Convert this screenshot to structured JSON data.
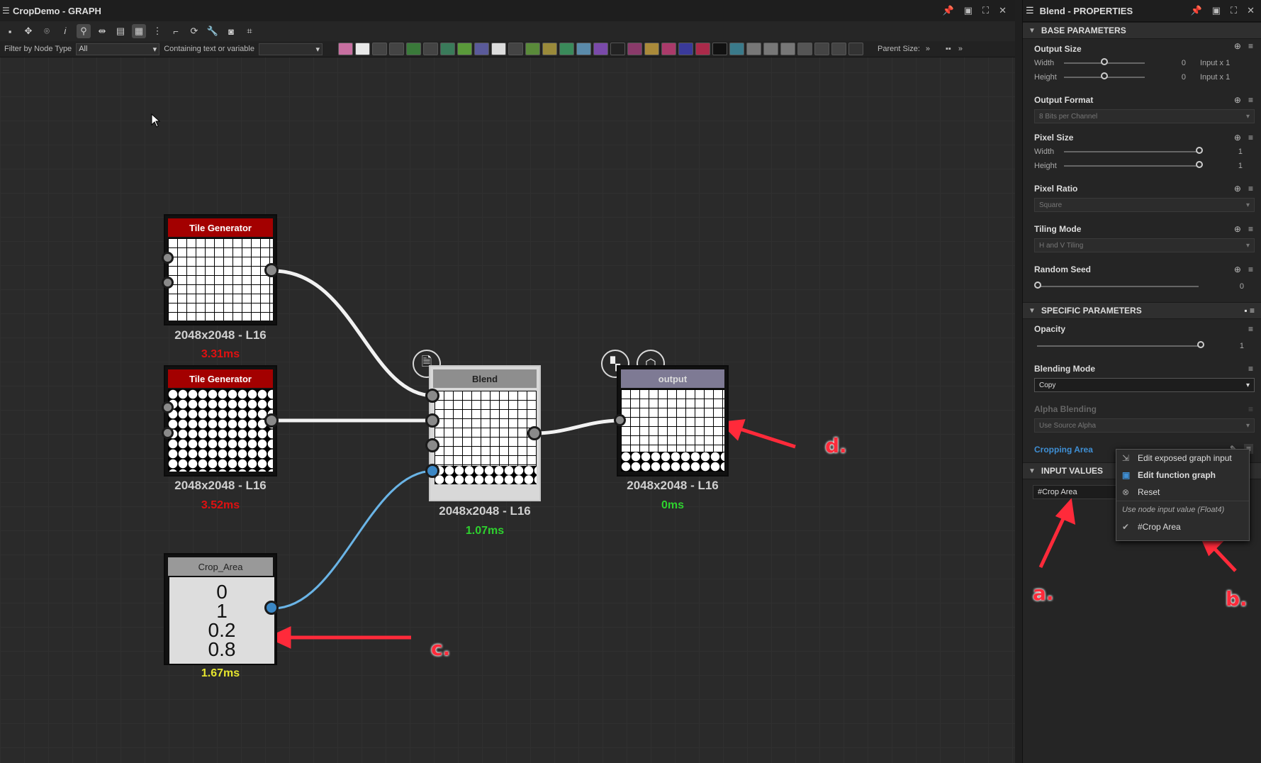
{
  "graph_window": {
    "title": "CropDemo - GRAPH",
    "filter_label": "Filter by Node Type",
    "filter_value": "All",
    "containing_label": "Containing text or variable",
    "containing_value": "",
    "parent_size_label": "Parent Size:"
  },
  "nodes": {
    "tile1": {
      "title": "Tile Generator",
      "resolution": "2048x2048 - L16",
      "time": "3.31ms",
      "time_color": "#e01010"
    },
    "tile2": {
      "title": "Tile Generator",
      "resolution": "2048x2048 - L16",
      "time": "3.52ms",
      "time_color": "#e01010"
    },
    "blend": {
      "title": "Blend",
      "resolution": "2048x2048 - L16",
      "time": "1.07ms",
      "time_color": "#2ed12e"
    },
    "output": {
      "title": "output",
      "resolution": "2048x2048 - L16",
      "time": "0ms",
      "time_color": "#2ed12e"
    },
    "crop": {
      "title": "Crop_Area",
      "values": [
        "0",
        "1",
        "0.2",
        "0.8"
      ],
      "time": "1.67ms",
      "time_color": "#e6e62e"
    }
  },
  "annotations": {
    "a": "a.",
    "b": "b.",
    "c": "c.",
    "d": "d."
  },
  "properties": {
    "title": "Blend - PROPERTIES",
    "base_section": "BASE PARAMETERS",
    "output_size": {
      "name": "Output Size",
      "width_label": "Width",
      "height_label": "Height",
      "width_value": "0",
      "height_value": "0",
      "width_mode": "Input x 1",
      "height_mode": "Input x 1"
    },
    "output_format": {
      "name": "Output Format",
      "value": "8 Bits per Channel"
    },
    "pixel_size": {
      "name": "Pixel Size",
      "width_label": "Width",
      "height_label": "Height",
      "width_value": "1",
      "height_value": "1"
    },
    "pixel_ratio": {
      "name": "Pixel Ratio",
      "value": "Square"
    },
    "tiling_mode": {
      "name": "Tiling Mode",
      "value": "H and V Tiling"
    },
    "random_seed": {
      "name": "Random Seed",
      "value": "0"
    },
    "specific_section": "SPECIFIC PARAMETERS",
    "opacity": {
      "name": "Opacity",
      "value": "1"
    },
    "blending_mode": {
      "name": "Blending Mode",
      "value": "Copy"
    },
    "alpha_blending": {
      "name": "Alpha Blending",
      "value": "Use Source Alpha"
    },
    "cropping_area": {
      "name": "Cropping Area"
    },
    "input_section": "INPUT VALUES",
    "input_field_value": "#Crop Area"
  },
  "context_menu": {
    "item1": "Edit exposed graph input",
    "item2": "Edit function graph",
    "item3": "Reset",
    "note": "Use node input value (Float4)",
    "item4": "#Crop Area"
  },
  "colors": {
    "accent_blue": "#3f8fd4",
    "annotation_red": "#ff2a3a"
  }
}
